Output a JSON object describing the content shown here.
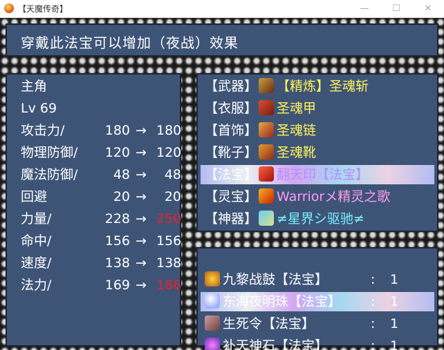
{
  "window": {
    "title": "【天魔传奇】"
  },
  "help": {
    "text": "穿戴此法宝可以增加（夜战）效果"
  },
  "character": {
    "name": "主角",
    "level": "Lv 69"
  },
  "stats": [
    {
      "label": "攻击力/",
      "old": "180",
      "arrow": "→",
      "new": "180",
      "change": "same"
    },
    {
      "label": "物理防御/",
      "old": "120",
      "arrow": "→",
      "new": "120",
      "change": "same"
    },
    {
      "label": "魔法防御/",
      "old": "48",
      "arrow": "→",
      "new": "48",
      "change": "same"
    },
    {
      "label": "回避",
      "old": "20",
      "arrow": "→",
      "new": "20",
      "change": "same"
    },
    {
      "label": "力量/",
      "old": "228",
      "arrow": "→",
      "new": "250",
      "change": "up"
    },
    {
      "label": "命中/",
      "old": "156",
      "arrow": "→",
      "new": "156",
      "change": "same"
    },
    {
      "label": "速度/",
      "old": "138",
      "arrow": "→",
      "new": "138",
      "change": "same"
    },
    {
      "label": "法力/",
      "old": "169",
      "arrow": "→",
      "new": "186",
      "change": "up"
    }
  ],
  "equipment": [
    {
      "slot": "【武器】",
      "item": "【精炼】圣魂斩",
      "icon": "sword-icon"
    },
    {
      "slot": "【衣服】",
      "item": "圣魂甲",
      "icon": "armor-icon"
    },
    {
      "slot": "【首饰】",
      "item": "圣魂链",
      "icon": "necklace-icon"
    },
    {
      "slot": "【靴子】",
      "item": "圣魂靴",
      "icon": "boots-icon"
    },
    {
      "slot": "【法宝】",
      "item": "翻天印【法宝】",
      "icon": "treasure-icon"
    },
    {
      "slot": "【灵宝】",
      "item": "Warriorメ精灵之歌",
      "icon": "spirit-icon"
    },
    {
      "slot": "【神器】",
      "item": "≠星界シ驱驰≠",
      "icon": "artifact-icon"
    }
  ],
  "inventory": [
    {
      "name": "九黎战鼓【法宝】",
      "colon": ":",
      "count": "1",
      "icon": "drum-icon"
    },
    {
      "name": "东海夜明珠【法宝】",
      "colon": ":",
      "count": "1",
      "icon": "pearl-icon"
    },
    {
      "name": "生死令【法宝】",
      "colon": ":",
      "count": "1",
      "icon": "token-icon"
    },
    {
      "name": "补天神石【法宝】",
      "colon": ":",
      "count": "1",
      "icon": "stone-icon"
    }
  ],
  "colors": {
    "panel": "#3e5477",
    "stat_up": "#e8202a",
    "equip_name": "#fff35a",
    "spirit_name": "#ff9cf0",
    "artifact_name": "#78f0ff"
  }
}
